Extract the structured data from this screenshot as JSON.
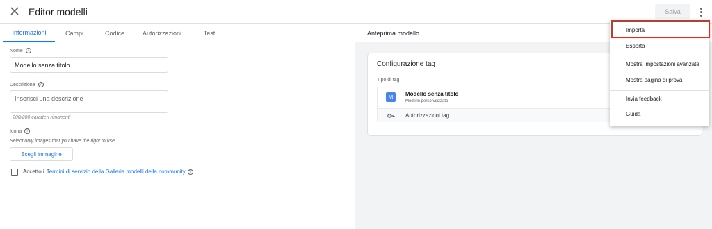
{
  "header": {
    "title": "Editor modelli",
    "save_label": "Salva"
  },
  "tabs": [
    {
      "label": "Informazioni",
      "active": true
    },
    {
      "label": "Campi",
      "active": false
    },
    {
      "label": "Codice",
      "active": false
    },
    {
      "label": "Autorizzazioni",
      "active": false
    },
    {
      "label": "Test",
      "active": false
    }
  ],
  "form": {
    "name_label": "Nome",
    "name_value": "Modello senza titolo",
    "description_label": "Descrizione",
    "description_placeholder": "Inserisci una descrizione",
    "description_counter": "200/200 caratteri rimanenti",
    "icon_label": "Icona",
    "icon_hint": "Select only images that you have the right to use",
    "choose_image_label": "Scegli immagine",
    "terms_prefix": "Accetto i",
    "terms_link": "Termini di servizio della Galleria modelli della community"
  },
  "preview": {
    "title": "Anteprima modello",
    "card_title": "Configurazione tag",
    "tag_type_label": "Tipo di tag",
    "tag_icon_letter": "M",
    "tag_name": "Modello senza titolo",
    "tag_subtitle": "Modello personalizzato",
    "permissions_label": "Autorizzazioni tag"
  },
  "menu": {
    "items": [
      {
        "label": "Importa",
        "highlighted": true
      },
      {
        "label": "Esporta"
      },
      {
        "label": "Mostra impostazioni avanzate"
      },
      {
        "label": "Mostra pagina di prova"
      },
      {
        "label": "Invia feedback"
      },
      {
        "label": "Guida"
      }
    ]
  },
  "colors": {
    "accent": "#1a73e8",
    "highlight": "#d93025",
    "tag_icon": "#4285f4"
  }
}
